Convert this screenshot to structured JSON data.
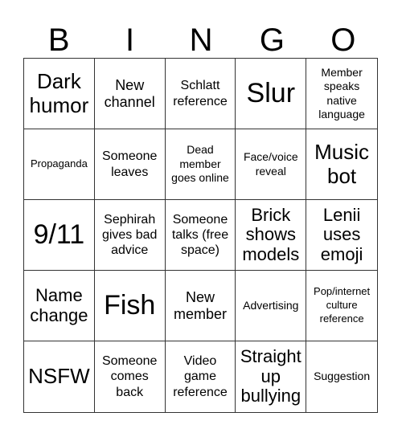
{
  "header": {
    "letters": [
      "B",
      "I",
      "N",
      "G",
      "O"
    ]
  },
  "cells": [
    "Dark humor",
    "New channel",
    "Schlatt reference",
    "Slur",
    "Member speaks native language",
    "Propaganda",
    "Someone leaves",
    "Dead member goes online",
    "Face/voice reveal",
    "Music bot",
    "9/11",
    "Sephirah gives bad advice",
    "Someone talks (free space)",
    "Brick shows models",
    "Lenii uses emoji",
    "Name change",
    "Fish",
    "New member",
    "Advertising",
    "Pop/internet culture reference",
    "NSFW",
    "Someone comes back",
    "Video game reference",
    "Straight up bullying",
    "Suggestion"
  ]
}
